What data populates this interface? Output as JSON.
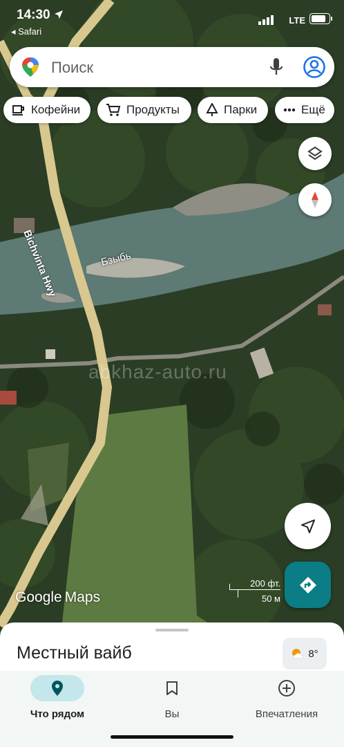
{
  "status_bar": {
    "time": "14:30",
    "back_app": "◂ Safari",
    "network": "LTE"
  },
  "search": {
    "placeholder": "Поиск"
  },
  "chips": [
    {
      "label": "Кофейни",
      "icon": "coffee-icon"
    },
    {
      "label": "Продукты",
      "icon": "cart-icon"
    },
    {
      "label": "Парки",
      "icon": "tree-icon"
    },
    {
      "label": "Ещё",
      "icon": "more-dots-icon"
    }
  ],
  "map": {
    "road_label": "Bichvinta Hwy",
    "river_label": "Бзыбь",
    "watermark": "abkhaz-auto.ru",
    "scale_feet": "200 фт.",
    "scale_meters": "50 м",
    "brand": {
      "google": "Google",
      "maps": "Maps"
    }
  },
  "sheet": {
    "title": "Местный вайб"
  },
  "weather": {
    "temp": "8°",
    "icon": "partly-sunny-icon"
  },
  "nav": [
    {
      "label": "Что рядом",
      "icon": "location-pin-icon",
      "active": true
    },
    {
      "label": "Вы",
      "icon": "bookmark-icon",
      "active": false
    },
    {
      "label": "Впечатления",
      "icon": "add-circle-icon",
      "active": false
    }
  ],
  "colors": {
    "accent": "#0b7d86",
    "active_pill": "#c3e7ea",
    "nav_bg": "#f2f6f5"
  }
}
